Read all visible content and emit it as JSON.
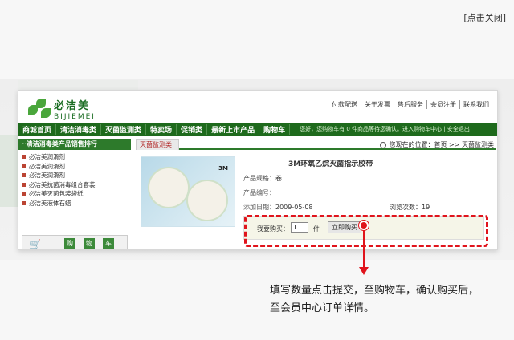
{
  "close_label": "[点击关闭]",
  "brand": {
    "cn": "必洁美",
    "en": "BIJIEMEI"
  },
  "toplinks": [
    "付款配送",
    "关于发票",
    "售后服务",
    "会员注册",
    "联系我们"
  ],
  "nav": {
    "items": [
      "商城首页",
      "清洁消毒类",
      "灭菌监测类",
      "特卖场",
      "促销类",
      "最新上市产品",
      "购物车"
    ],
    "cart_message": "您好，您购物车有 0 件商品等待您确认。进入购物车中心 | 安全退出"
  },
  "sidebar": {
    "heading": "~清洁消毒类产品销售排行",
    "items": [
      "必洁美润滑剂",
      "必洁美润滑剂",
      "必洁美润滑剂",
      "必洁美抗菌消毒组合套装",
      "必洁美灭菌包装袋纸",
      "必洁美液体石蜡"
    ],
    "promo_chars": [
      "购",
      "物",
      "车"
    ]
  },
  "main": {
    "tab_label": "灭菌监测类",
    "breadcrumb": "您现在的位置：首页 >> 灭菌监测类",
    "product": {
      "title": "3M环氧乙烷灭菌指示胶带",
      "spec_label": "产品规格：",
      "spec_value": "卷",
      "code_label": "产品编号：",
      "code_value": "",
      "date_label": "添加日期：",
      "date_value": "2009-05-08",
      "views_label": "浏览次数：",
      "views_value": "19",
      "image_badge": "3M"
    },
    "buy": {
      "label": "我要购买：",
      "quantity": "1",
      "unit": "件",
      "button": "立即购买"
    }
  },
  "instruction": "填写数量点击提交，至购物车，确认购买后，至会员中心订单详情。",
  "colors": {
    "nav_green": "#1e6a1c",
    "highlight_red": "#e0141c"
  }
}
